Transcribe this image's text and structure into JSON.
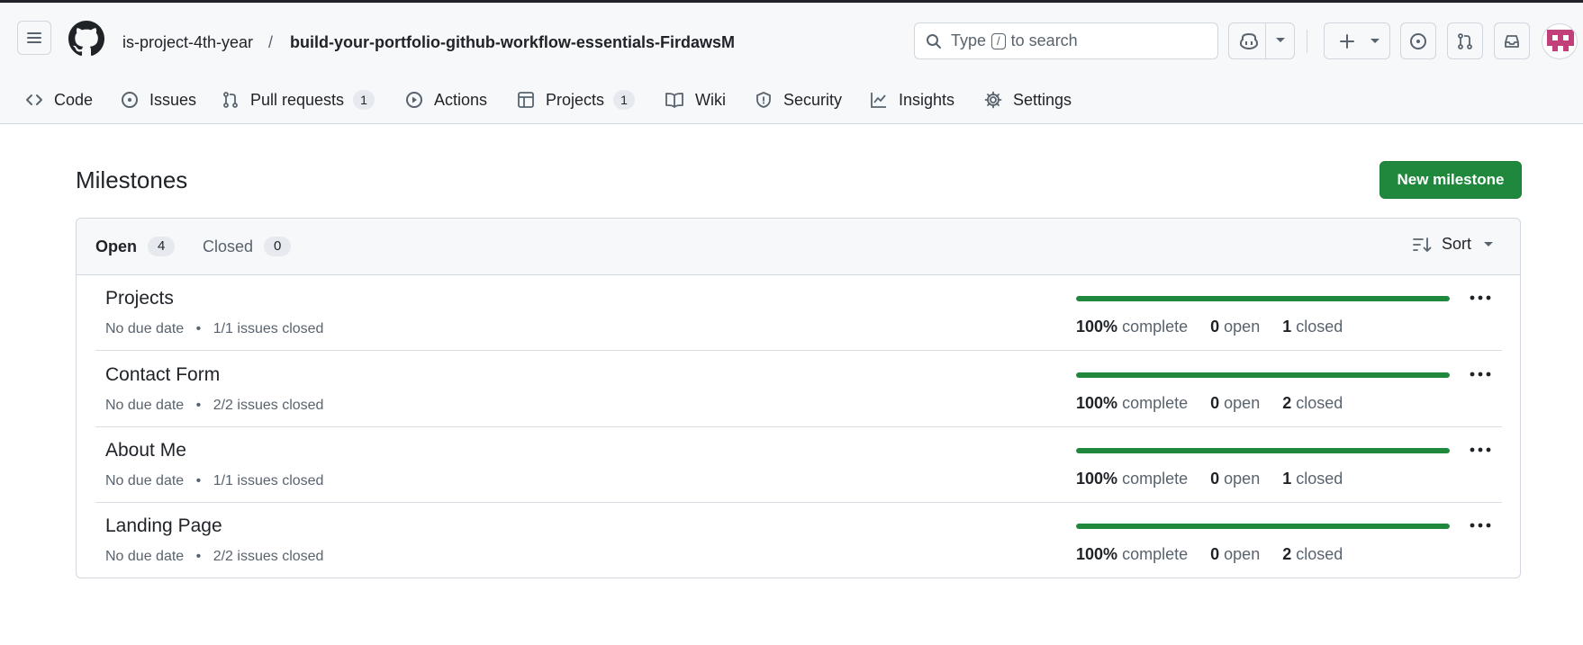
{
  "header": {
    "owner": "is-project-4th-year",
    "separator": "/",
    "repo": "build-your-portfolio-github-workflow-essentials-FirdawsM",
    "search": {
      "prefix": "Type",
      "key": "/",
      "suffix": "to search"
    }
  },
  "icons": {
    "menu": "hamburger-icon",
    "logo": "github-mark-icon",
    "search": "search-icon",
    "copilot": "copilot-icon",
    "plus": "plus-icon",
    "issues": "issue-opened-icon",
    "pulls": "git-pull-request-icon",
    "inbox": "inbox-icon",
    "sort": "sort-desc-icon",
    "kebab": "kebab-horizontal-icon"
  },
  "nav": {
    "tabs": [
      {
        "label": "Code",
        "icon": "code-icon"
      },
      {
        "label": "Issues",
        "icon": "issue-opened-icon"
      },
      {
        "label": "Pull requests",
        "icon": "git-pull-request-icon",
        "count": "1"
      },
      {
        "label": "Actions",
        "icon": "play-icon"
      },
      {
        "label": "Projects",
        "icon": "table-icon",
        "count": "1"
      },
      {
        "label": "Wiki",
        "icon": "book-icon"
      },
      {
        "label": "Security",
        "icon": "shield-icon"
      },
      {
        "label": "Insights",
        "icon": "graph-icon"
      },
      {
        "label": "Settings",
        "icon": "gear-icon"
      }
    ]
  },
  "main": {
    "title": "Milestones",
    "new_button": "New milestone",
    "filters": {
      "open": {
        "label": "Open",
        "count": "4"
      },
      "closed": {
        "label": "Closed",
        "count": "0"
      },
      "sort": "Sort"
    },
    "milestones": [
      {
        "title": "Projects",
        "due": "No due date",
        "bullet": "•",
        "issues": "1/1 issues closed",
        "progress": 1.0,
        "percent": "100%",
        "complete_label": "complete",
        "open": "0",
        "open_label": "open",
        "closed": "1",
        "closed_label": "closed"
      },
      {
        "title": "Contact Form",
        "due": "No due date",
        "bullet": "•",
        "issues": "2/2 issues closed",
        "progress": 1.0,
        "percent": "100%",
        "complete_label": "complete",
        "open": "0",
        "open_label": "open",
        "closed": "2",
        "closed_label": "closed"
      },
      {
        "title": "About Me",
        "due": "No due date",
        "bullet": "•",
        "issues": "1/1 issues closed",
        "progress": 1.0,
        "percent": "100%",
        "complete_label": "complete",
        "open": "0",
        "open_label": "open",
        "closed": "1",
        "closed_label": "closed"
      },
      {
        "title": "Landing Page",
        "due": "No due date",
        "bullet": "•",
        "issues": "2/2 issues closed",
        "progress": 1.0,
        "percent": "100%",
        "complete_label": "complete",
        "open": "0",
        "open_label": "open",
        "closed": "2",
        "closed_label": "closed"
      }
    ]
  },
  "colors": {
    "accent": "#1f883d",
    "text": "#1f2328",
    "muted": "#59636e",
    "border": "#d0d7de",
    "avatar": "#c2407a"
  }
}
